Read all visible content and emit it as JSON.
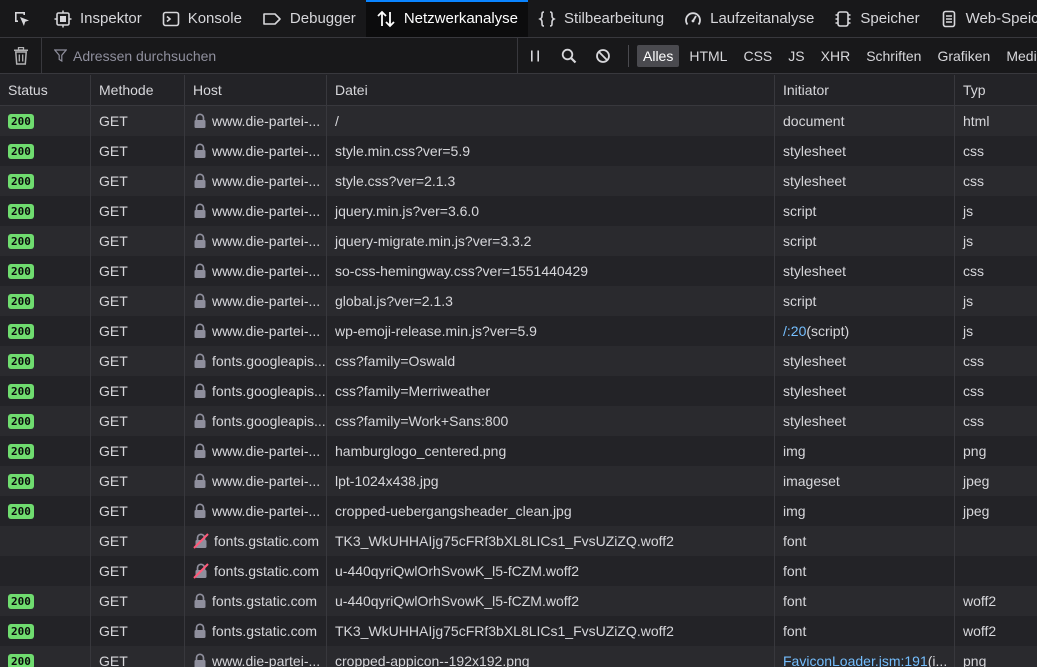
{
  "tabs": [
    {
      "label": "Inspektor",
      "icon": "inspector-icon",
      "active": false
    },
    {
      "label": "Konsole",
      "icon": "console-icon",
      "active": false
    },
    {
      "label": "Debugger",
      "icon": "debugger-icon",
      "active": false
    },
    {
      "label": "Netzwerkanalyse",
      "icon": "network-icon",
      "active": true
    },
    {
      "label": "Stilbearbeitung",
      "icon": "braces-icon",
      "active": false
    },
    {
      "label": "Laufzeitanalyse",
      "icon": "gauge-icon",
      "active": false
    },
    {
      "label": "Speicher",
      "icon": "memory-icon",
      "active": false
    },
    {
      "label": "Web-Speich",
      "icon": "storage-icon",
      "active": false
    }
  ],
  "toolbar": {
    "filter_placeholder": "Adressen durchsuchen",
    "type_filters": [
      "Alles",
      "HTML",
      "CSS",
      "JS",
      "XHR",
      "Schriften",
      "Grafiken",
      "Medien"
    ]
  },
  "columns": [
    "Status",
    "Methode",
    "Host",
    "Datei",
    "Initiator",
    "Typ"
  ],
  "rows": [
    {
      "status": "200",
      "method": "GET",
      "host": "www.die-partei-...",
      "secure": true,
      "file": "/",
      "initiator": "document",
      "type": "html"
    },
    {
      "status": "200",
      "method": "GET",
      "host": "www.die-partei-...",
      "secure": true,
      "file": "style.min.css?ver=5.9",
      "initiator": "stylesheet",
      "type": "css"
    },
    {
      "status": "200",
      "method": "GET",
      "host": "www.die-partei-...",
      "secure": true,
      "file": "style.css?ver=2.1.3",
      "initiator": "stylesheet",
      "type": "css"
    },
    {
      "status": "200",
      "method": "GET",
      "host": "www.die-partei-...",
      "secure": true,
      "file": "jquery.min.js?ver=3.6.0",
      "initiator": "script",
      "type": "js"
    },
    {
      "status": "200",
      "method": "GET",
      "host": "www.die-partei-...",
      "secure": true,
      "file": "jquery-migrate.min.js?ver=3.3.2",
      "initiator": "script",
      "type": "js"
    },
    {
      "status": "200",
      "method": "GET",
      "host": "www.die-partei-...",
      "secure": true,
      "file": "so-css-hemingway.css?ver=1551440429",
      "initiator": "stylesheet",
      "type": "css"
    },
    {
      "status": "200",
      "method": "GET",
      "host": "www.die-partei-...",
      "secure": true,
      "file": "global.js?ver=2.1.3",
      "initiator": "script",
      "type": "js"
    },
    {
      "status": "200",
      "method": "GET",
      "host": "www.die-partei-...",
      "secure": true,
      "file": "wp-emoji-release.min.js?ver=5.9",
      "initiator": "/:20",
      "initiator_suffix": " (script)",
      "initiator_link": true,
      "type": "js"
    },
    {
      "status": "200",
      "method": "GET",
      "host": "fonts.googleapis...",
      "secure": true,
      "file": "css?family=Oswald",
      "initiator": "stylesheet",
      "type": "css"
    },
    {
      "status": "200",
      "method": "GET",
      "host": "fonts.googleapis...",
      "secure": true,
      "file": "css?family=Merriweather",
      "initiator": "stylesheet",
      "type": "css"
    },
    {
      "status": "200",
      "method": "GET",
      "host": "fonts.googleapis...",
      "secure": true,
      "file": "css?family=Work+Sans:800",
      "initiator": "stylesheet",
      "type": "css"
    },
    {
      "status": "200",
      "method": "GET",
      "host": "www.die-partei-...",
      "secure": true,
      "file": "hamburglogo_centered.png",
      "initiator": "img",
      "type": "png"
    },
    {
      "status": "200",
      "method": "GET",
      "host": "www.die-partei-...",
      "secure": true,
      "file": "lpt-1024x438.jpg",
      "initiator": "imageset",
      "type": "jpeg"
    },
    {
      "status": "200",
      "method": "GET",
      "host": "www.die-partei-...",
      "secure": true,
      "file": "cropped-uebergangsheader_clean.jpg",
      "initiator": "img",
      "type": "jpeg"
    },
    {
      "status": "",
      "method": "GET",
      "host": "fonts.gstatic.com",
      "secure": false,
      "file": "TK3_WkUHHAIjg75cFRf3bXL8LICs1_FvsUZiZQ.woff2",
      "initiator": "font",
      "type": ""
    },
    {
      "status": "",
      "method": "GET",
      "host": "fonts.gstatic.com",
      "secure": false,
      "file": "u-440qyriQwlOrhSvowK_l5-fCZM.woff2",
      "initiator": "font",
      "type": ""
    },
    {
      "status": "200",
      "method": "GET",
      "host": "fonts.gstatic.com",
      "secure": true,
      "file": "u-440qyriQwlOrhSvowK_l5-fCZM.woff2",
      "initiator": "font",
      "type": "woff2"
    },
    {
      "status": "200",
      "method": "GET",
      "host": "fonts.gstatic.com",
      "secure": true,
      "file": "TK3_WkUHHAIjg75cFRf3bXL8LICs1_FvsUZiZQ.woff2",
      "initiator": "font",
      "type": "woff2"
    },
    {
      "status": "200",
      "method": "GET",
      "host": "www.die-partei-...",
      "secure": true,
      "file": "cropped-appicon--192x192.png",
      "initiator": "FaviconLoader.jsm:191",
      "initiator_suffix": " (i...",
      "initiator_link": true,
      "type": "png"
    }
  ],
  "colors": {
    "accent": "#0a84ff",
    "status_ok": "#6fdc6f",
    "link": "#75bfff"
  }
}
